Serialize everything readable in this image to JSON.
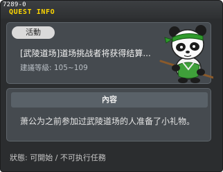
{
  "window": {
    "quest_id": "7289-0",
    "title": "QUEST INFO"
  },
  "quest": {
    "category": "活動",
    "name": "[武陵道场]道场挑战者将获得结算...",
    "recommend_level": "建議等級: 105~109"
  },
  "npc": {
    "icon": "panda-npc-icon"
  },
  "content": {
    "header": "內容",
    "text": "萧公为之前参加过武陵道场的人准备了小礼物。"
  },
  "status": {
    "text": "狀態: 可開始 / 不可执行任務"
  },
  "colors": {
    "title": "#ffd700",
    "background": "#2b2d2f",
    "panel": "#454a4f"
  }
}
